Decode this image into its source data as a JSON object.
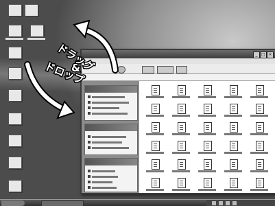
{
  "overlay": {
    "caption_line1": "ドラッグ",
    "caption_amp": "&",
    "caption_line2": "ドロップ"
  },
  "icons": {
    "arrow_up": "curved-arrow-up-icon",
    "arrow_down": "curved-arrow-down-icon",
    "file": "document-icon",
    "folder": "folder-icon"
  },
  "colors": {
    "arrow": "#ffffff",
    "arrow_outline": "#000000",
    "desktop": "#8e8e8e",
    "window_frame": "#3a3a3a"
  }
}
